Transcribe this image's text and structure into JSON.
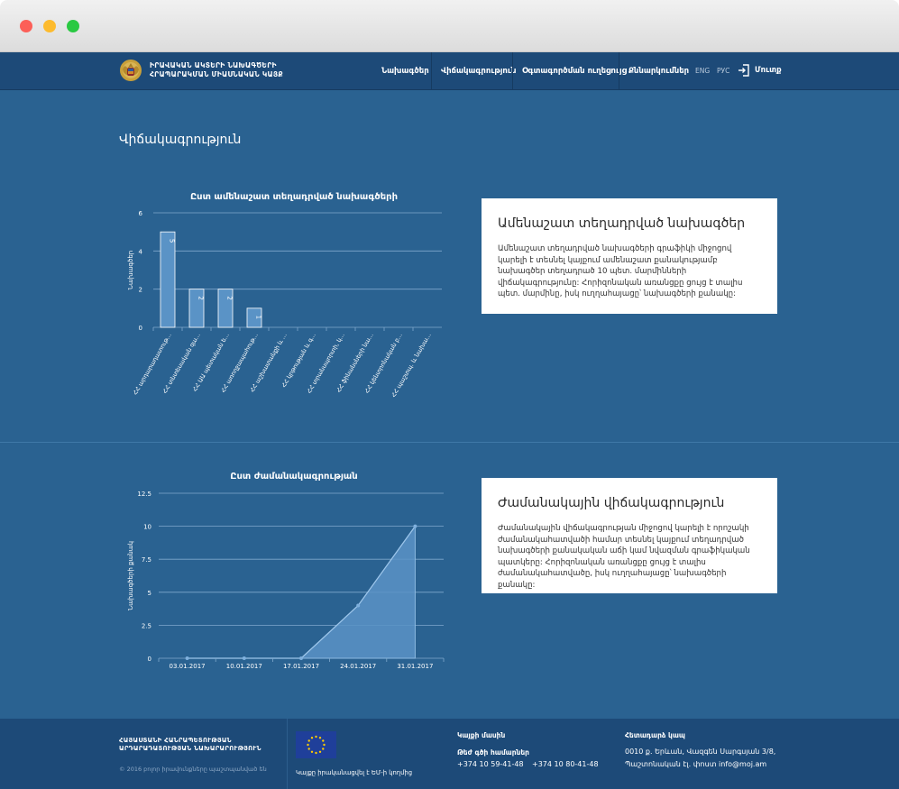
{
  "header": {
    "org_line1": "ԻՐԱՎԱԿԱՆ ԱԿՏԵՐԻ ՆԱԽԱԳԾԵՐԻ",
    "org_line2": "ՀՐԱՊԱՐԱԿՄԱՆ ՄԻԱՍՆԱԿԱՆ ԿԱՅՔ",
    "nav": [
      "Նախագծեր",
      "Վիճակագրություն",
      "Օգտագործման ուղեցույց",
      "Քննարկումներ"
    ],
    "lang_eng": "ENG",
    "lang_rus": "РУС",
    "login_label": "Մուտք"
  },
  "page": {
    "title": "Վիճակագրություն"
  },
  "section1": {
    "card_title": "Ամենաշատ տեղադրված նախագծեր",
    "card_text": "Ամենաշատ տեղադրված նախագծերի գրաֆիկի միջոցով կարելի է տեսնել կայքում ամենաշատ քանակությամբ նախագծեր տեղադրած 10 պետ. մարմինների վիճակագրությունը: Հորիզոնական առանցքը ցույց է տալիս պետ. մարմինը, իսկ ուղղահայացը՝ նախագծերի քանակը:"
  },
  "section2": {
    "card_title": "Ժամանակային վիճակագրություն",
    "card_text": "Ժամանակային վիճակագրության միջոցով կարելի է որոշակի ժամանակահատվածի համար տեսնել կայքում տեղադրված նախագծերի քանակական աճի կամ նվազման գրաֆիկական պատկերը: Հորիզոնական առանցքը ցույց է տալիս ժամանակահատվածը, իսկ ուղղահայացը՝ նախագծերի քանակը:"
  },
  "chart_data": [
    {
      "type": "bar",
      "title": "Ըստ ամենաշատ տեղադրված նախագծերի",
      "ylabel": "Նախագծեր",
      "xlabel": "",
      "ylim": [
        0,
        6
      ],
      "yticks": [
        0,
        2,
        4,
        6
      ],
      "categories": [
        "ՀՀ արդարադատութ...",
        "ՀՀ տնտեսական զա...",
        "ՀՀ ԱԱ պետական ե...",
        "ՀՀ առողջապահութ...",
        "ՀՀ աշխատանքի և ...",
        "ՀՀ կրթության և գ...",
        "ՀՀ տրանսպորտի, կ...",
        "ՀՀ ֆինանսների նա...",
        "ՀՀ կենտրոնական բ...",
        "ՀՀ պաշտպ. և նախա..."
      ],
      "values": [
        5,
        2,
        2,
        1,
        0,
        0,
        0,
        0,
        0,
        0
      ],
      "grid": true,
      "bar_color": "#5a93c6"
    },
    {
      "type": "area",
      "title": "Ըստ ժամանակագրության",
      "ylabel": "Նախագծերի քանակ",
      "xlabel": "",
      "ylim": [
        0,
        12.5
      ],
      "yticks": [
        0,
        2.5,
        5,
        7.5,
        10,
        12.5
      ],
      "x": [
        "03.01.2017",
        "10.01.2017",
        "17.01.2017",
        "24.01.2017",
        "31.01.2017"
      ],
      "values": [
        0,
        0,
        0,
        4,
        10
      ],
      "grid": true,
      "fill_color": "#5a93c6"
    }
  ],
  "footer": {
    "ministry_line1": "ՀԱՅԱՍՏԱՆԻ ՀԱՆՐԱՊԵՏՈՒԹՅԱՆ",
    "ministry_line2": "ԱՐԴԱՐԱԴԱՏՈՒԹՅԱՆ ՆԱԽԱՐԱՐՈՒԹՅՈՒՆ",
    "copyright": "© 2016 բոլոր իրավունքները պաշտպանված են",
    "eu_note": "Կայքը իրականացվել է ԵՄ-ի կողմից",
    "about_heading": "Կայքի մասին",
    "hotline_heading": "Թեժ գծի համարներ",
    "phone1": "+374 10 59-41-48",
    "phone2": "+374 10 80-41-48",
    "contact_heading": "Հետադարձ կապ",
    "address_line1": "0010 ք. Երևան, Վազգեն Սարգսյան 3/8,",
    "address_line2": "Պաշտոնական էլ. փոստ info@moj.am"
  }
}
